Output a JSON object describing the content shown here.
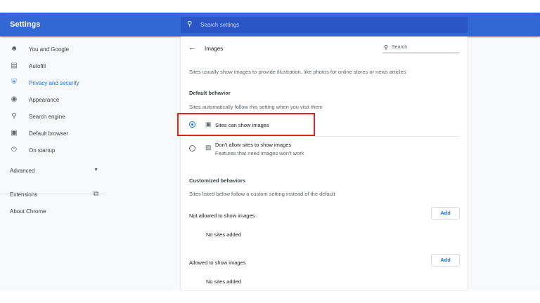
{
  "header": {
    "title": "Settings",
    "search_placeholder": "Search settings"
  },
  "sidebar": {
    "items": [
      {
        "label": "You and Google",
        "icon": "person-icon"
      },
      {
        "label": "Autofill",
        "icon": "clipboard-icon"
      },
      {
        "label": "Privacy and security",
        "icon": "shield-icon",
        "active": true
      },
      {
        "label": "Appearance",
        "icon": "palette-icon"
      },
      {
        "label": "Search engine",
        "icon": "search-icon"
      },
      {
        "label": "Default browser",
        "icon": "browser-icon"
      },
      {
        "label": "On startup",
        "icon": "power-icon"
      }
    ],
    "advanced": "Advanced",
    "extensions": "Extensions",
    "about": "About Chrome"
  },
  "page": {
    "title": "Images",
    "search_placeholder": "Search",
    "description": "Sites usually show images to provide illustration, like photos for online stores or news articles",
    "default_heading": "Default behavior",
    "default_sub": "Sites automatically follow this setting when you visit them",
    "option_allow": "Sites can show images",
    "option_block": "Don't allow sites to show images",
    "option_block_sub": "Features that need images won't work",
    "custom_heading": "Customized behaviors",
    "custom_sub": "Sites listed below follow a custom setting instead of the default",
    "not_allowed_label": "Not allowed to show images",
    "allowed_label": "Allowed to show images",
    "add": "Add",
    "no_sites": "No sites added"
  }
}
